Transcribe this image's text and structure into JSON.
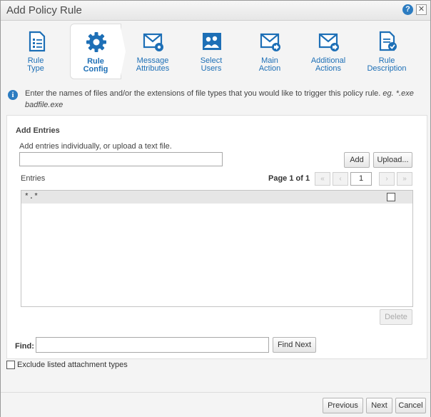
{
  "dialog": {
    "title": "Add Policy Rule",
    "help_label": "?",
    "close_label": "✕"
  },
  "wizard": {
    "steps": [
      {
        "line1": "Rule",
        "line2": "Type",
        "icon": "document-list-icon"
      },
      {
        "line1": "Rule",
        "line2": "Config",
        "icon": "gear-icon",
        "active": true
      },
      {
        "line1": "Message",
        "line2": "Attributes",
        "icon": "envelope-gear-icon"
      },
      {
        "line1": "Select",
        "line2": "Users",
        "icon": "users-icon"
      },
      {
        "line1": "Main",
        "line2": "Action",
        "icon": "envelope-arrow-icon"
      },
      {
        "line1": "Additional",
        "line2": "Actions",
        "icon": "envelope-arrow-icon"
      },
      {
        "line1": "Rule",
        "line2": "Description",
        "icon": "document-check-icon"
      }
    ]
  },
  "info": {
    "text": "Enter the names of files and/or the extensions of file types that you would like to trigger this policy rule.",
    "example_prefix": "eg.",
    "example": "*.exe badfile.exe"
  },
  "entries": {
    "section_title": "Add Entries",
    "hint": "Add entries individually, or upload a text file.",
    "input_value": "",
    "add_label": "Add",
    "upload_label": "Upload...",
    "list_label": "Entries",
    "page_text": "Page 1 of 1",
    "page_value": "1",
    "first_label": "«",
    "prev_label": "‹",
    "next_label": "›",
    "last_label": "»",
    "items": [
      "*.*"
    ],
    "delete_label": "Delete"
  },
  "find": {
    "label": "Find:",
    "value": "",
    "button_label": "Find Next"
  },
  "exclude": {
    "label": "Exclude listed attachment types",
    "checked": false
  },
  "footer": {
    "previous_label": "Previous",
    "next_label": "Next",
    "cancel_label": "Cancel"
  },
  "colors": {
    "accent": "#1d6fb6",
    "info_icon": "#2c7cc1"
  }
}
